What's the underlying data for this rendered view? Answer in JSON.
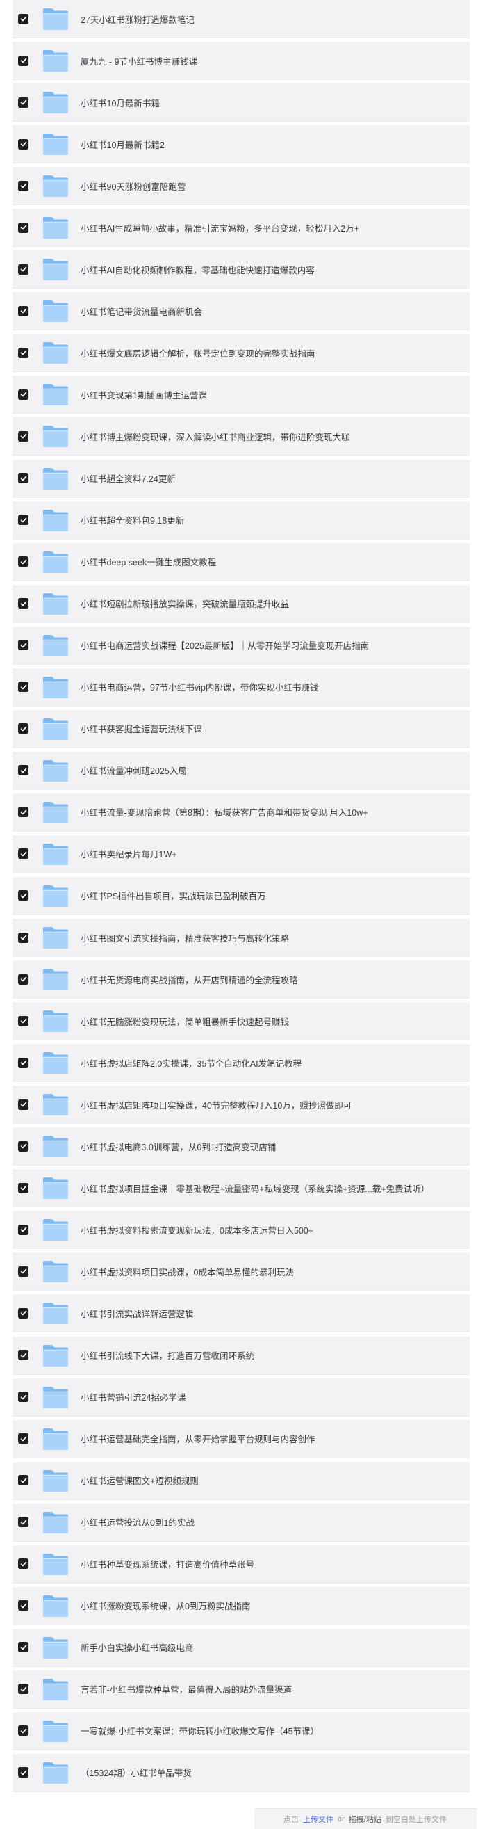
{
  "items": [
    {
      "label": "27天小红书涨粉打造爆款笔记",
      "checked": true,
      "icon": "folder-icon"
    },
    {
      "label": "厦九九 - 9节小红书博主赚钱课",
      "checked": true,
      "icon": "folder-icon"
    },
    {
      "label": "小红书10月最新书籍",
      "checked": true,
      "icon": "folder-icon"
    },
    {
      "label": "小红书10月最新书籍2",
      "checked": true,
      "icon": "folder-icon"
    },
    {
      "label": "小红书90天涨粉创富陪跑营",
      "checked": true,
      "icon": "folder-icon"
    },
    {
      "label": "小红书AI生成睡前小故事，精准引流宝妈粉，多平台变现，轻松月入2万+",
      "checked": true,
      "icon": "folder-icon"
    },
    {
      "label": "小红书AI自动化视频制作教程，零基础也能快速打造爆款内容",
      "checked": true,
      "icon": "folder-icon"
    },
    {
      "label": "小红书笔记带货流量电商新机会",
      "checked": true,
      "icon": "folder-icon"
    },
    {
      "label": "小红书爆文底层逻辑全解析，账号定位到变现的完整实战指南",
      "checked": true,
      "icon": "folder-icon"
    },
    {
      "label": "小红书变现第1期插画博主运营课",
      "checked": true,
      "icon": "folder-icon"
    },
    {
      "label": "小红书博主爆粉变现课，深入解读小红书商业逻辑，带你进阶变现大咖",
      "checked": true,
      "icon": "folder-icon"
    },
    {
      "label": "小红书超全资料7.24更新",
      "checked": true,
      "icon": "folder-icon"
    },
    {
      "label": "小红书超全资料包9.18更新",
      "checked": true,
      "icon": "folder-icon"
    },
    {
      "label": "小红书deep seek一键生成图文教程",
      "checked": true,
      "icon": "folder-icon"
    },
    {
      "label": "小红书短剧拉新玻播放实操课，突破流量瓶颈提升收益",
      "checked": true,
      "icon": "folder-icon"
    },
    {
      "label": "小红书电商运营实战课程【2025最新版】｜从零开始学习流量变现开店指南",
      "checked": true,
      "icon": "folder-icon"
    },
    {
      "label": "小红书电商运营，97节小红书vip内部课，带你实现小红书赚钱",
      "checked": true,
      "icon": "folder-icon"
    },
    {
      "label": "小红书获客掘金运营玩法线下课",
      "checked": true,
      "icon": "folder-icon"
    },
    {
      "label": "小红书流量冲刺班2025入局",
      "checked": true,
      "icon": "folder-icon"
    },
    {
      "label": "小红书流量-变现陪跑营（第8期）：私域获客广告商单和带货变现 月入10w+",
      "checked": true,
      "icon": "folder-icon"
    },
    {
      "label": "小红书卖纪录片每月1W+",
      "checked": true,
      "icon": "folder-icon"
    },
    {
      "label": "小红书PS插件出售项目，实战玩法已盈利破百万",
      "checked": true,
      "icon": "folder-icon"
    },
    {
      "label": "小红书图文引流实操指南，精准获客技巧与高转化策略",
      "checked": true,
      "icon": "folder-icon"
    },
    {
      "label": "小红书无货源电商实战指南，从开店到精通的全流程攻略",
      "checked": true,
      "icon": "folder-icon"
    },
    {
      "label": "小红书无脑涨粉变现玩法，简单粗暴新手快速起号赚钱",
      "checked": true,
      "icon": "folder-icon"
    },
    {
      "label": "小红书虚拟店矩阵2.0实操课，35节全自动化AI发笔记教程",
      "checked": true,
      "icon": "folder-icon"
    },
    {
      "label": "小红书虚拟店矩阵项目实操课，40节完整教程月入10万，照抄照做即可",
      "checked": true,
      "icon": "folder-icon"
    },
    {
      "label": "小红书虚拟电商3.0训练营，从0到1打造高变现店铺",
      "checked": true,
      "icon": "folder-icon"
    },
    {
      "label": "小红书虚拟项目掘金课｜零基础教程+流量密码+私域变现（系统实操+资源...载+免费试听）",
      "checked": true,
      "icon": "folder-icon"
    },
    {
      "label": "小红书虚拟资料搜索流变现新玩法，0成本多店运营日入500+",
      "checked": true,
      "icon": "folder-icon"
    },
    {
      "label": "小红书虚拟资料项目实战课，0成本简单易懂的暴利玩法",
      "checked": true,
      "icon": "folder-icon"
    },
    {
      "label": "小红书引流实战详解运营逻辑",
      "checked": true,
      "icon": "folder-icon"
    },
    {
      "label": "小红书引流线下大课，打造百万营收闭环系统",
      "checked": true,
      "icon": "folder-icon"
    },
    {
      "label": "小红书营销引流24招必学课",
      "checked": true,
      "icon": "folder-icon"
    },
    {
      "label": "小红书运营基础完全指南，从零开始掌握平台规则与内容创作",
      "checked": true,
      "icon": "folder-icon"
    },
    {
      "label": "小红书运营课图文+短视频规则",
      "checked": true,
      "icon": "folder-icon"
    },
    {
      "label": "小红书运营投流从0到1的实战",
      "checked": true,
      "icon": "folder-icon"
    },
    {
      "label": "小红书种草变现系统课，打造高价值种草账号",
      "checked": true,
      "icon": "folder-icon"
    },
    {
      "label": "小红书涨粉变现系统课，从0到万粉实战指南",
      "checked": true,
      "icon": "folder-icon"
    },
    {
      "label": "新手小白实操小红书高级电商",
      "checked": true,
      "icon": "folder-icon"
    },
    {
      "label": "言若非-小红书爆款种草营，最值得入局的站外流量渠道",
      "checked": true,
      "icon": "folder-icon"
    },
    {
      "label": "一写就爆-小红书文案课：带你玩转小红收爆文写作（45节课）",
      "checked": true,
      "icon": "folder-icon"
    },
    {
      "label": "（15324期）小红书单品带货",
      "checked": true,
      "icon": "folder-icon"
    }
  ],
  "footer": {
    "click_text": "点击",
    "upload_link": "上传文件",
    "or_text": "or",
    "drag_text": "拖拽/粘贴",
    "rest_text": "到空白处上传文件"
  },
  "colors": {
    "row_background": "#f2f2f4",
    "checkbox": "#1f1f1f",
    "folder_light": "#a9d3fb",
    "folder_dark": "#7db9f2",
    "link": "#3d6fd6"
  }
}
